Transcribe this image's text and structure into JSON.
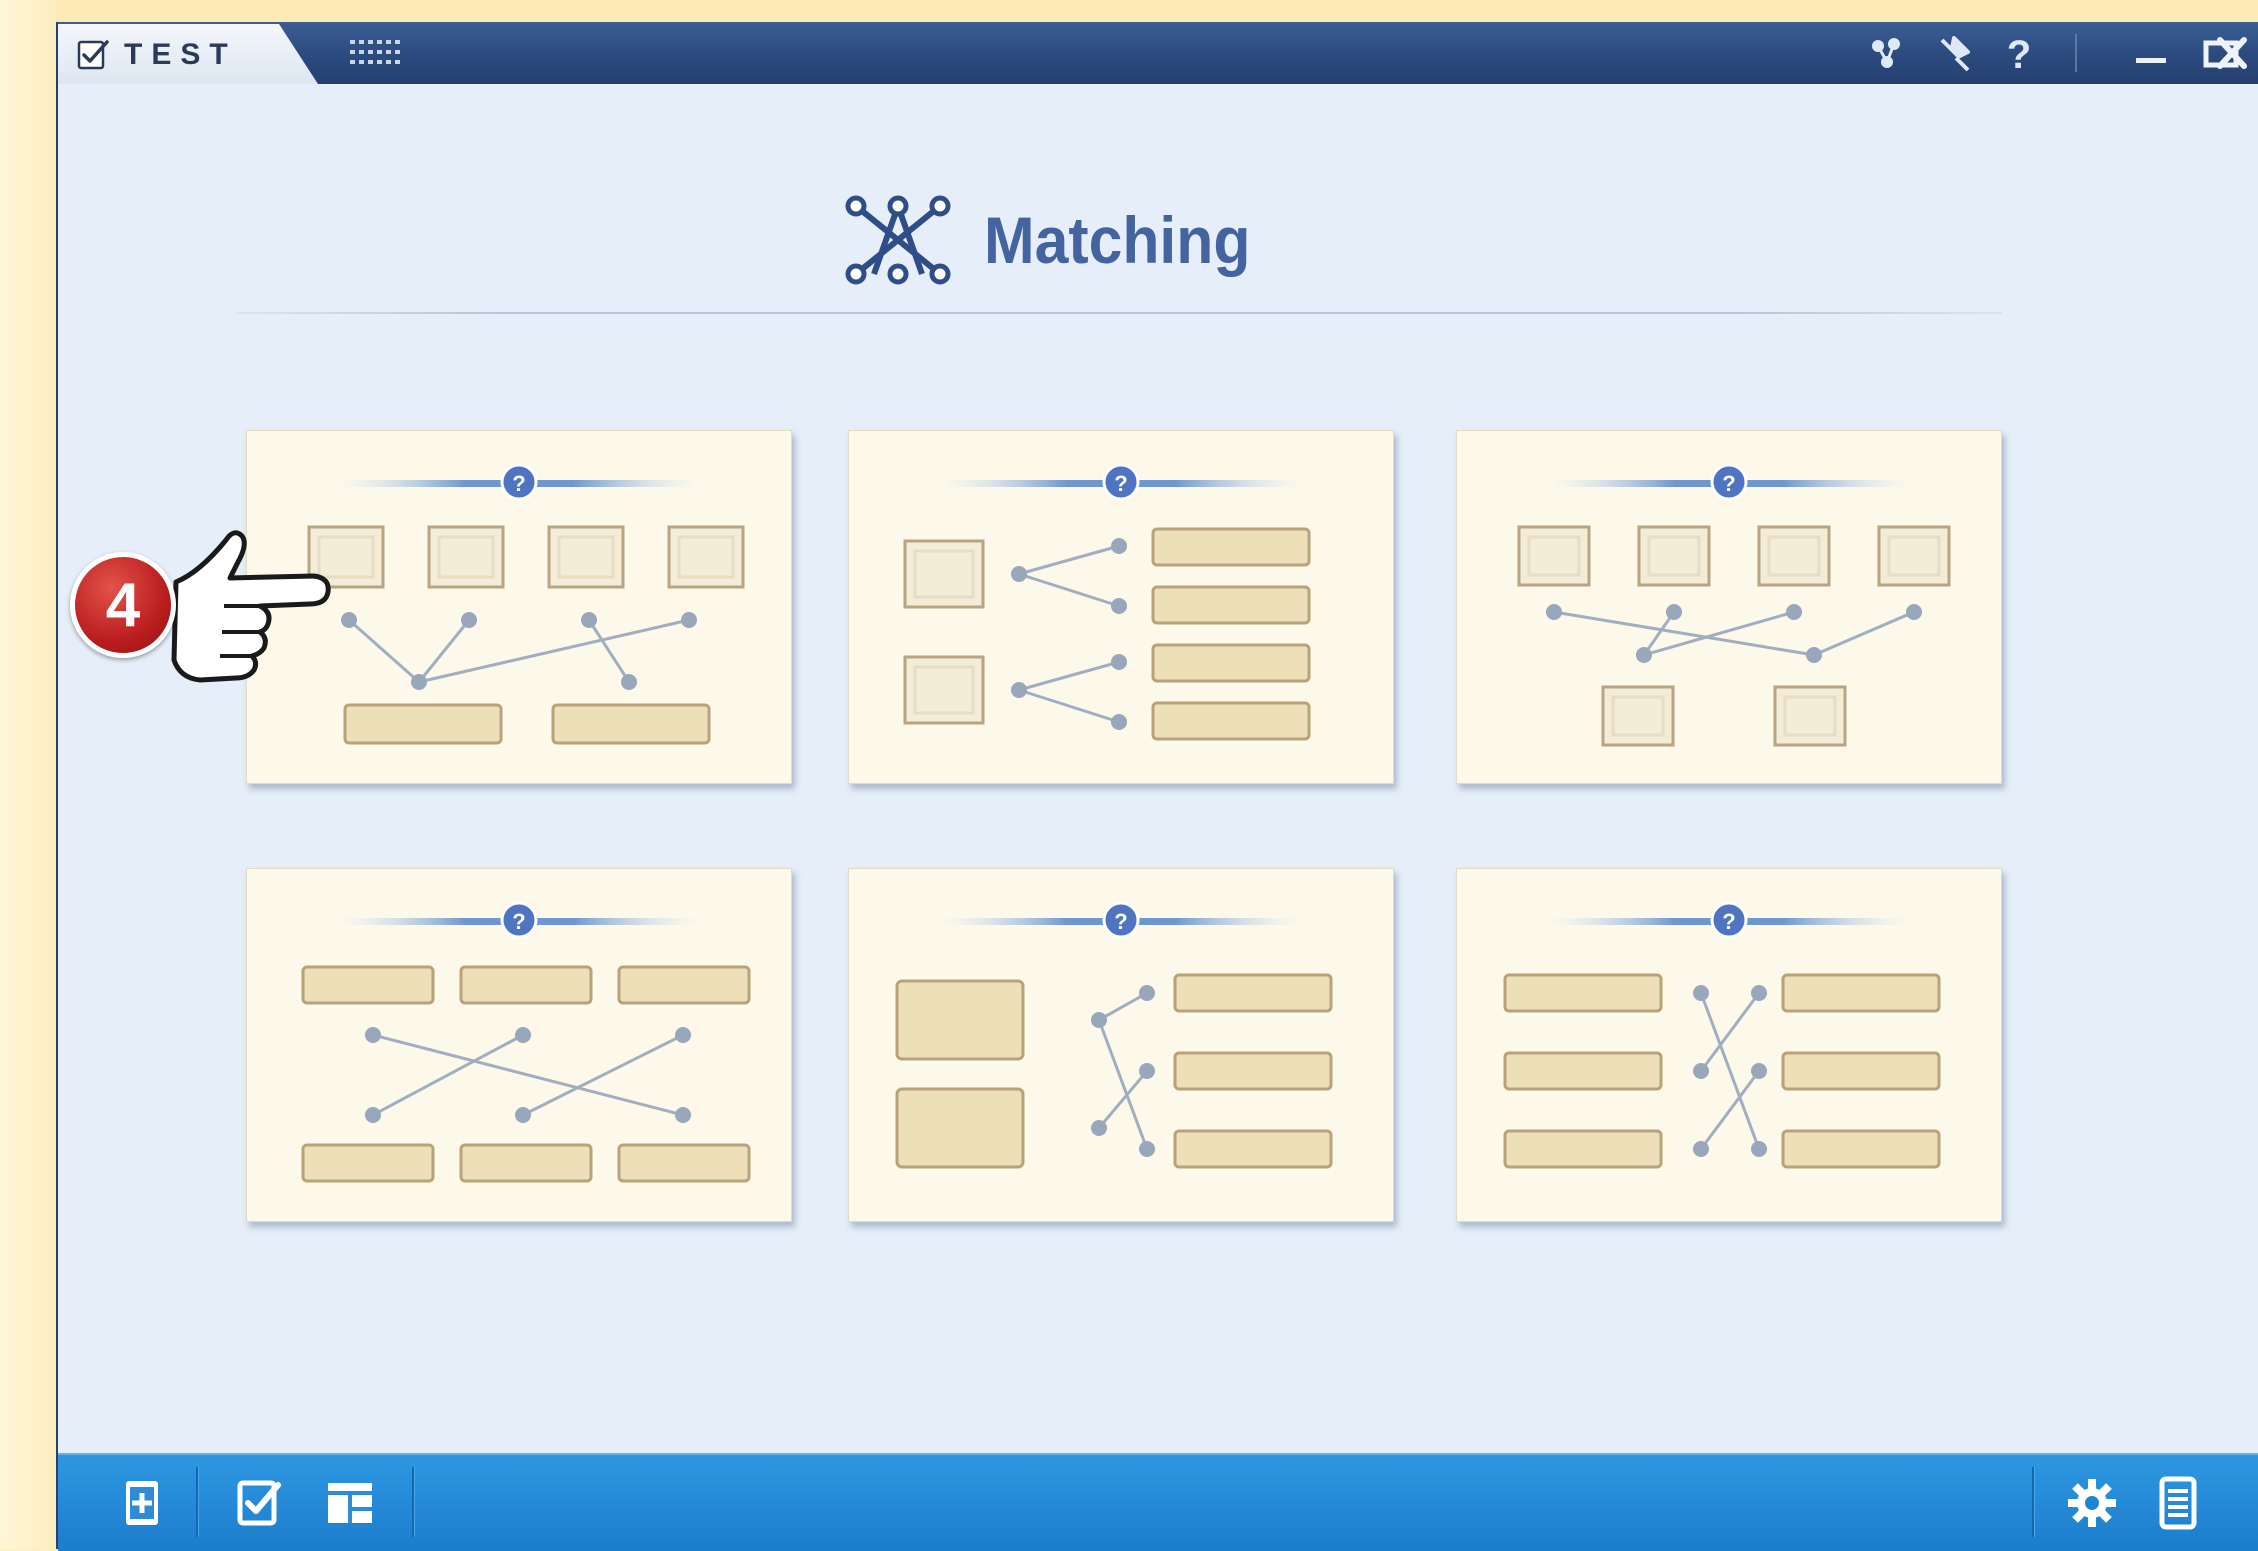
{
  "app": {
    "name": "TEST"
  },
  "titlebar": {
    "buttons": [
      {
        "name": "network-icon"
      },
      {
        "name": "pin-icon"
      },
      {
        "name": "help-icon",
        "glyph": "?"
      },
      {
        "name": "minimize-icon"
      },
      {
        "name": "maximize-icon"
      },
      {
        "name": "close-icon"
      }
    ]
  },
  "page": {
    "title": "Matching",
    "title_icon": "matching-icon"
  },
  "templates": [
    {
      "id": "template-1",
      "layout": "4 images top, 2 text boxes bottom, linked"
    },
    {
      "id": "template-2",
      "layout": "2 images left, 4 text boxes right, linked"
    },
    {
      "id": "template-3",
      "layout": "4 images top, 2 images bottom, linked"
    },
    {
      "id": "template-4",
      "layout": "3 text boxes top, 3 text boxes bottom, crossed"
    },
    {
      "id": "template-5",
      "layout": "2 large text boxes left, 3 text boxes right, crossed"
    },
    {
      "id": "template-6",
      "layout": "3 text boxes left, 3 text boxes right, crossed"
    }
  ],
  "callout": {
    "step": "4",
    "pointer_icon": "pointing-hand-icon"
  },
  "bottom_toolbar": {
    "left": [
      "add-page-icon",
      "check-edit-icon",
      "layout-icon"
    ],
    "right": [
      "settings-icon",
      "document-list-icon"
    ]
  },
  "colors": {
    "titlebar": "#2b4a7e",
    "title_text": "#4464a0",
    "card_bg": "#fcf9ea",
    "toolbar": "#1b7dcb",
    "badge": "#bb1e1e"
  }
}
